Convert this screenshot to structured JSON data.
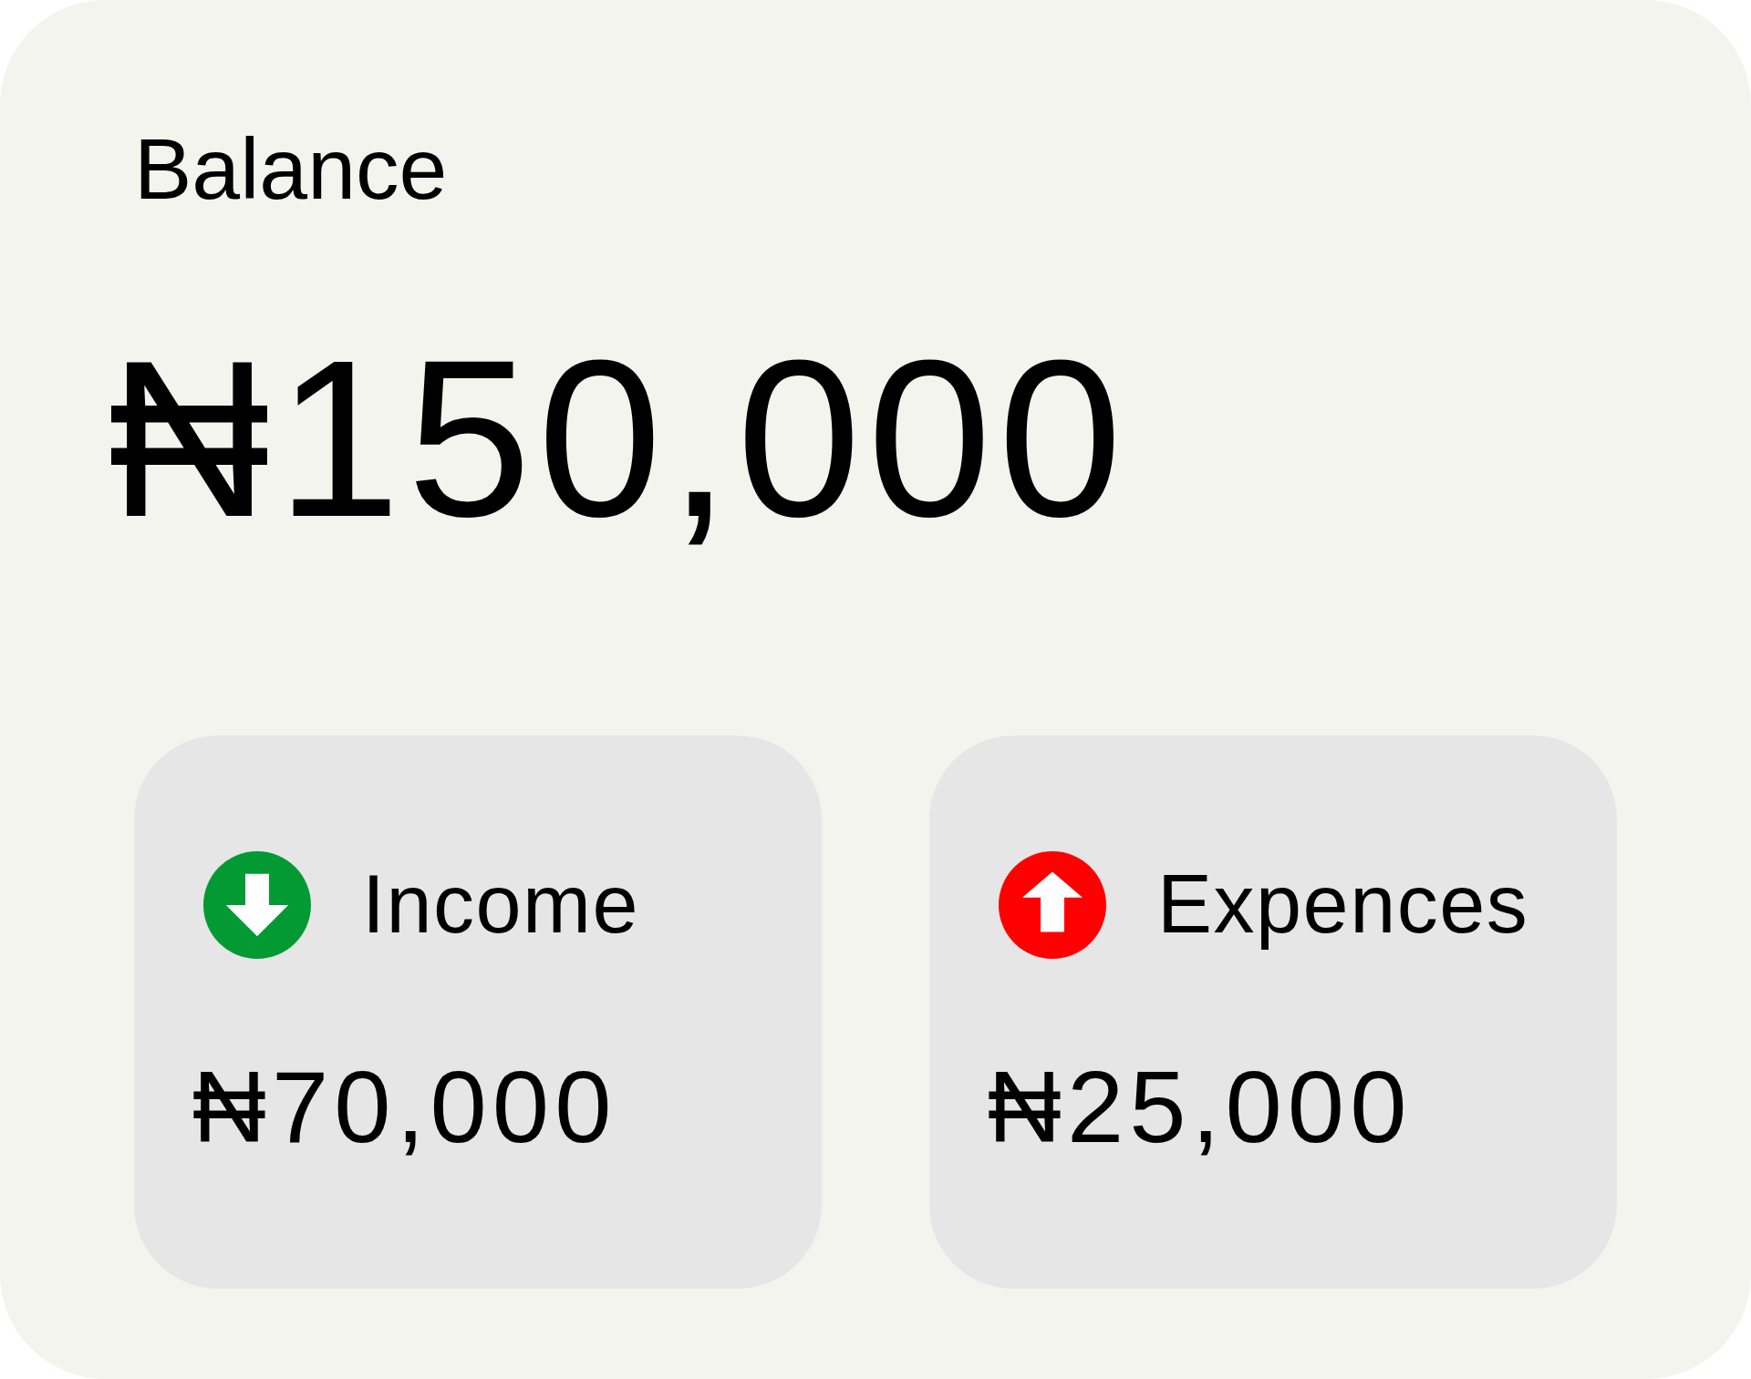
{
  "balance": {
    "label": "Balance",
    "amount": "₦150,000"
  },
  "summary_cards": [
    {
      "kind": "income",
      "label": "Income",
      "amount": "₦70,000",
      "color": "#039a34"
    },
    {
      "kind": "expense",
      "label": "Expences",
      "amount": "₦25,000",
      "color": "#ff0000"
    }
  ]
}
